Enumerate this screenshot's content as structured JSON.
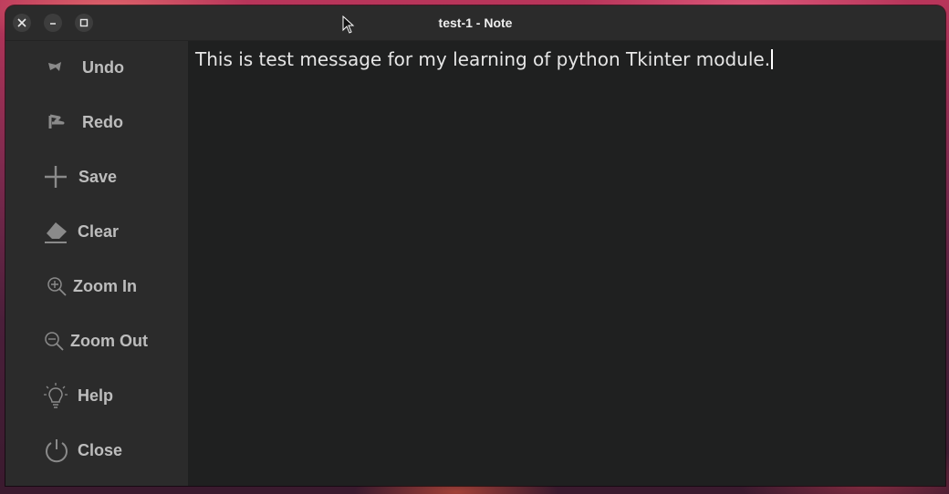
{
  "window": {
    "title": "test-1  -  Note"
  },
  "titlebar_buttons": {
    "close_icon": "close-icon",
    "minimize_icon": "minimize-icon",
    "maximize_icon": "maximize-icon"
  },
  "sidebar": {
    "items": [
      {
        "label": "Undo",
        "icon": "undo-icon"
      },
      {
        "label": "Redo",
        "icon": "redo-icon"
      },
      {
        "label": "Save",
        "icon": "plus-icon"
      },
      {
        "label": "Clear",
        "icon": "eraser-icon"
      },
      {
        "label": "Zoom In",
        "icon": "zoom-in-icon"
      },
      {
        "label": "Zoom Out",
        "icon": "zoom-out-icon"
      },
      {
        "label": "Help",
        "icon": "lightbulb-icon"
      },
      {
        "label": "Close",
        "icon": "power-icon"
      }
    ]
  },
  "editor": {
    "content": "This is test message for my learning of python Tkinter module."
  },
  "colors": {
    "window_bg": "#2b2b2b",
    "editor_bg": "#1f2020",
    "sidebar_text": "#bdbdbd",
    "editor_text": "#e6e6e6"
  }
}
